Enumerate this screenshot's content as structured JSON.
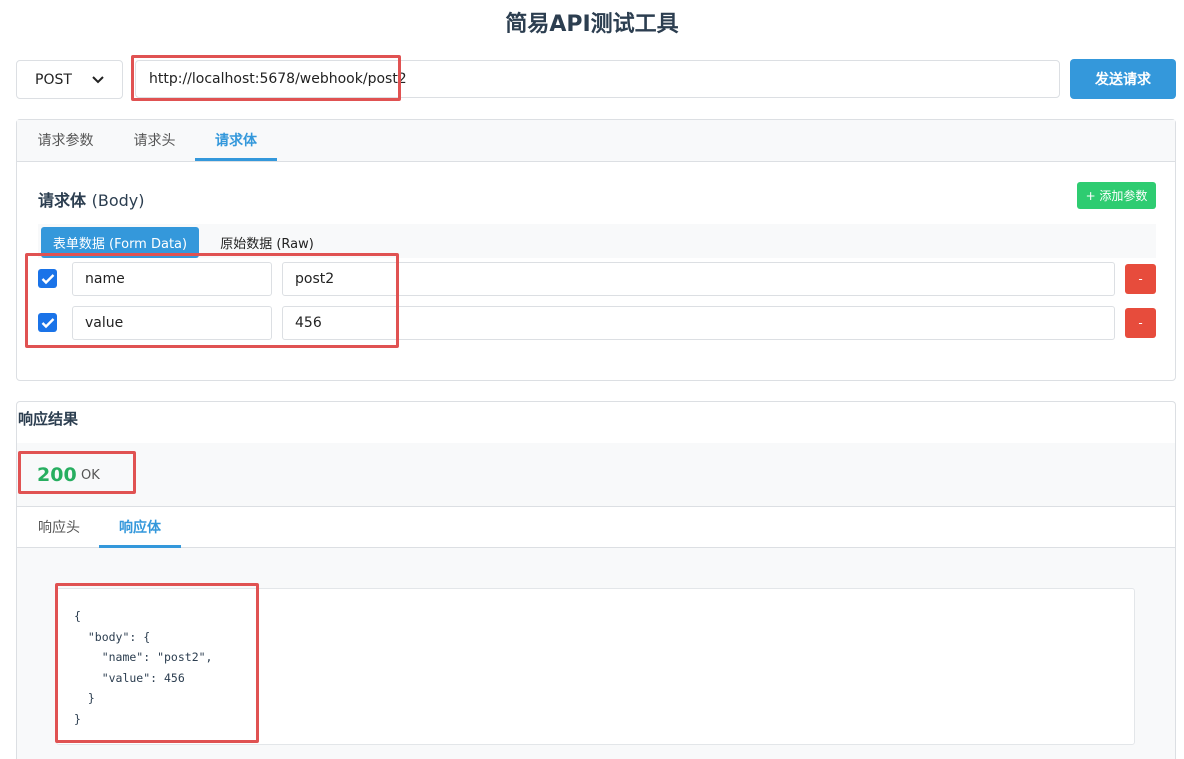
{
  "app": {
    "title": "简易API测试工具"
  },
  "request": {
    "method": "POST",
    "url": "http://localhost:5678/webhook/post2",
    "send_label": "发送请求",
    "tabs": [
      {
        "label": "请求参数",
        "active": false
      },
      {
        "label": "请求头",
        "active": false
      },
      {
        "label": "请求体",
        "active": true
      }
    ],
    "body": {
      "title": "请求体",
      "title_sub": "(Body)",
      "add_label": "+ 添加参数",
      "modes": [
        {
          "label": "表单数据 (Form Data)",
          "active": true
        },
        {
          "label": "原始数据 (Raw)",
          "active": false
        }
      ],
      "params": [
        {
          "checked": true,
          "key": "name",
          "value": "post2",
          "remove_label": "-"
        },
        {
          "checked": true,
          "key": "value",
          "value": "456",
          "remove_label": "-"
        }
      ]
    }
  },
  "response": {
    "title": "响应结果",
    "status_code": "200",
    "status_text": "OK",
    "tabs": [
      {
        "label": "响应头",
        "active": false
      },
      {
        "label": "响应体",
        "active": true
      }
    ],
    "body_json": "{\n  \"body\": {\n    \"name\": \"post2\",\n    \"value\": 456\n  }\n}"
  },
  "colors": {
    "accent": "#3498db",
    "success": "#2ecc71",
    "danger": "#e74c3c",
    "status_ok": "#27ae60",
    "highlight": "#e05252"
  }
}
